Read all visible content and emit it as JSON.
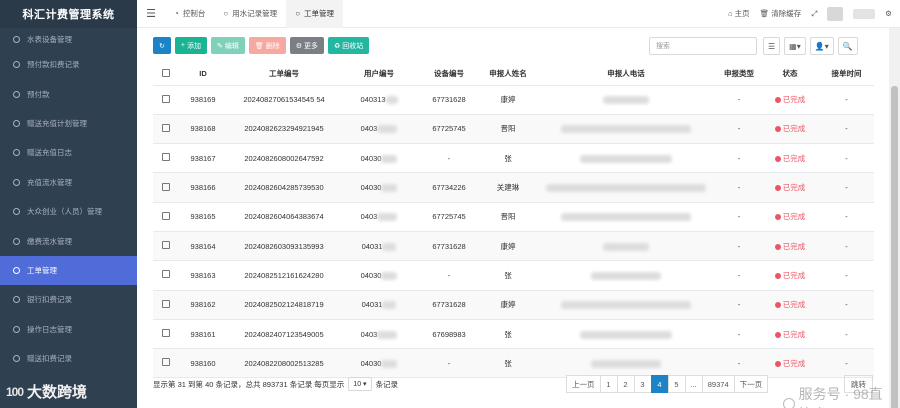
{
  "app": {
    "title": "科汇计费管理系统"
  },
  "sidebar": {
    "items": [
      {
        "label": "水表设备管理",
        "active": false
      },
      {
        "label": "预付款扣费记录",
        "active": false
      },
      {
        "label": "预付款",
        "active": false
      },
      {
        "label": "赠送充值计划管理",
        "active": false
      },
      {
        "label": "赠送充值日志",
        "active": false
      },
      {
        "label": "充值流水管理",
        "active": false
      },
      {
        "label": "大众创业（人员）管理",
        "active": false
      },
      {
        "label": "缴费流水管理",
        "active": false
      },
      {
        "label": "工单管理",
        "active": true
      },
      {
        "label": "银行扣费记录",
        "active": false
      },
      {
        "label": "操作日志管理",
        "active": false
      },
      {
        "label": "赠送扣费记录",
        "active": false
      }
    ],
    "watermark": {
      "logo": "100",
      "text": "大数跨境"
    }
  },
  "topbar": {
    "tabs": [
      {
        "label": "控制台",
        "icon": "dashboard-icon"
      },
      {
        "label": "用水记录管理",
        "icon": "circle-icon"
      },
      {
        "label": "工单管理",
        "icon": "circle-icon",
        "active": true
      }
    ],
    "home_label": "主页",
    "clear_cache_label": "清除缓存"
  },
  "toolbar": {
    "refresh_icon": "refresh-icon",
    "add_label": "添加",
    "edit_label": "编辑",
    "delete_label": "删除",
    "more_label": "更多",
    "recycle_label": "回收站",
    "search_placeholder": "搜索"
  },
  "table": {
    "headers": [
      "ID",
      "工单编号",
      "用户编号",
      "设备编号",
      "申报人姓名",
      "申报人电话",
      "申报类型",
      "状态",
      "接单时间"
    ],
    "rows": [
      {
        "id": "938169",
        "order_no": "20240827061534545 54",
        "user_no": "040313",
        "device_no": "67731628",
        "name": "康婷",
        "type": "-",
        "status": "已完成",
        "time": "-"
      },
      {
        "id": "938168",
        "order_no": "2024082623294921945",
        "user_no": "0403",
        "device_no": "67725745",
        "name": "晋阳",
        "type": "-",
        "status": "已完成",
        "time": "-"
      },
      {
        "id": "938167",
        "order_no": "2024082608002647592",
        "user_no": "04030",
        "device_no": "-",
        "name": "张",
        "type": "-",
        "status": "已完成",
        "time": "-"
      },
      {
        "id": "938166",
        "order_no": "2024082604285739530",
        "user_no": "04030",
        "device_no": "67734226",
        "name": "关建琳",
        "type": "-",
        "status": "已完成",
        "time": "-"
      },
      {
        "id": "938165",
        "order_no": "2024082604064383674",
        "user_no": "0403",
        "device_no": "67725745",
        "name": "晋阳",
        "type": "-",
        "status": "已完成",
        "time": "-"
      },
      {
        "id": "938164",
        "order_no": "2024082603093135993",
        "user_no": "04031",
        "device_no": "67731628",
        "name": "康婷",
        "type": "-",
        "status": "已完成",
        "time": "-"
      },
      {
        "id": "938163",
        "order_no": "2024082512161624280",
        "user_no": "04030",
        "device_no": "-",
        "name": "张",
        "type": "-",
        "status": "已完成",
        "time": "-"
      },
      {
        "id": "938162",
        "order_no": "2024082502124818719",
        "user_no": "04031",
        "device_no": "67731628",
        "name": "康婷",
        "type": "-",
        "status": "已完成",
        "time": "-"
      },
      {
        "id": "938161",
        "order_no": "2024082407123549005",
        "user_no": "0403",
        "device_no": "67698983",
        "name": "张",
        "type": "-",
        "status": "已完成",
        "time": "-"
      },
      {
        "id": "938160",
        "order_no": "2024082208002513285",
        "user_no": "04030",
        "device_no": "-",
        "name": "张",
        "type": "-",
        "status": "已完成",
        "time": "-"
      }
    ]
  },
  "footer": {
    "summary": "显示第 31 到第 40 条记录，总共 893731 条记录 每页显示",
    "page_size": "10",
    "suffix": "条记录",
    "pagination": [
      "上一页",
      "1",
      "2",
      "3",
      "4",
      "5",
      "...",
      "89374",
      "下一页"
    ],
    "active_page": "4",
    "jump_label": "跳转"
  },
  "watermark_right": {
    "text": "服务号 · 98直饮水"
  }
}
